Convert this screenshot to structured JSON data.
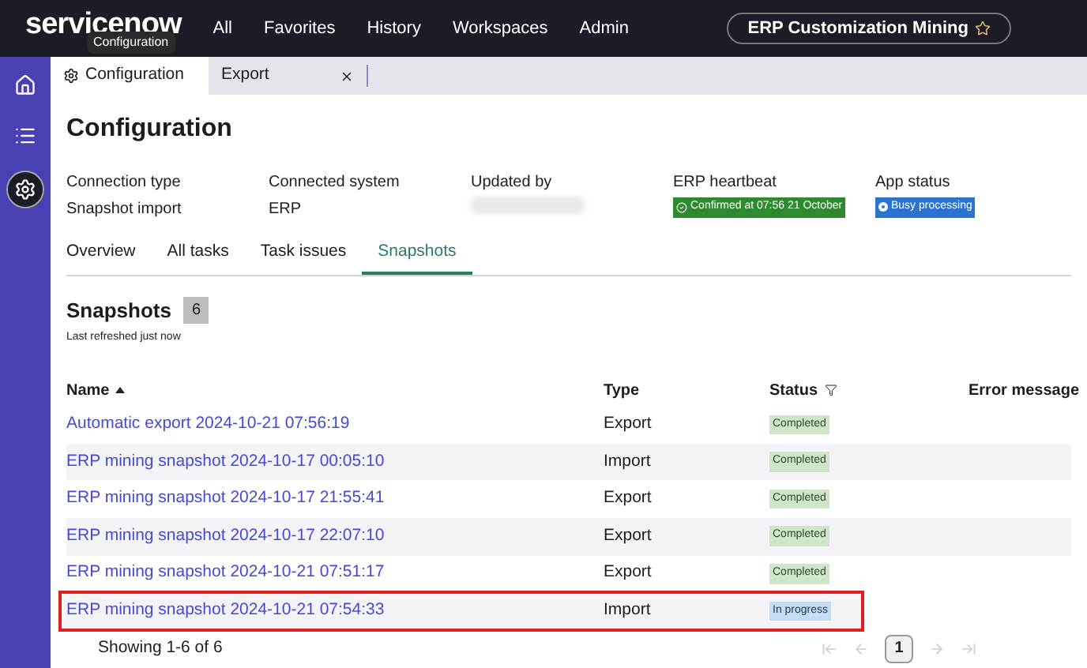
{
  "topbar": {
    "logo": "servicenow",
    "tooltip": "Configuration",
    "nav": [
      "All",
      "Favorites",
      "History",
      "Workspaces",
      "Admin"
    ],
    "app_pill": "ERP Customization Mining"
  },
  "sidebar": {
    "items": [
      {
        "kind": "home",
        "selected": false
      },
      {
        "kind": "list",
        "selected": false
      },
      {
        "kind": "settings",
        "selected": true
      }
    ]
  },
  "tabs": [
    {
      "label": "Configuration",
      "icon": true,
      "closable": false,
      "selected": true
    },
    {
      "label": "Export",
      "icon": false,
      "closable": true,
      "selected": false
    }
  ],
  "page_title": "Configuration",
  "info": [
    {
      "label": "Connection type",
      "value": "Snapshot import"
    },
    {
      "label": "Connected system",
      "value": "ERP"
    },
    {
      "label": "Updated by",
      "redacted": true
    },
    {
      "label": "ERP heartbeat",
      "badge": "Confirmed at 07:56 21 October",
      "kind": "success"
    },
    {
      "label": "App status",
      "badge": "Busy processing",
      "kind": "info"
    }
  ],
  "subtabs": [
    {
      "label": "Overview",
      "selected": false
    },
    {
      "label": "All tasks",
      "selected": false
    },
    {
      "label": "Task issues",
      "selected": false
    },
    {
      "label": "Snapshots",
      "selected": true
    }
  ],
  "section": {
    "title": "Snapshots",
    "count": "6",
    "subtitle": "Last refreshed just now"
  },
  "table": {
    "columns": [
      "Name",
      "Type",
      "Status",
      "Error message"
    ],
    "rows": [
      {
        "name": "Automatic export 2024-10-21 07:56:19",
        "type": "Export",
        "status": "Completed",
        "kind": "done",
        "highlighted": false
      },
      {
        "name": "ERP mining snapshot 2024-10-17 00:05:10",
        "type": "Import",
        "status": "Completed",
        "kind": "done",
        "highlighted": false
      },
      {
        "name": "ERP mining snapshot 2024-10-17 21:55:41",
        "type": "Export",
        "status": "Completed",
        "kind": "done",
        "highlighted": false
      },
      {
        "name": "ERP mining snapshot 2024-10-17 22:07:10",
        "type": "Export",
        "status": "Completed",
        "kind": "done",
        "highlighted": false
      },
      {
        "name": "ERP mining snapshot 2024-10-21 07:51:17",
        "type": "Export",
        "status": "Completed",
        "kind": "done",
        "highlighted": false
      },
      {
        "name": "ERP mining snapshot 2024-10-21 07:54:33",
        "type": "Import",
        "status": "In progress",
        "kind": "progress",
        "highlighted": true
      }
    ]
  },
  "footer": {
    "showing": "Showing 1-6 of 6",
    "page": "1"
  }
}
